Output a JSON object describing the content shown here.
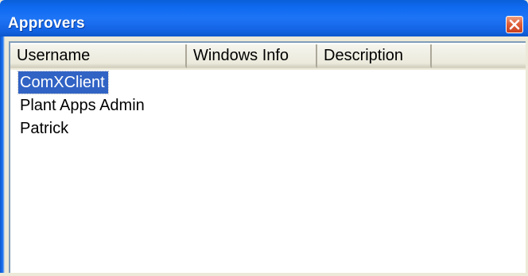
{
  "window": {
    "title": "Approvers",
    "close_icon": "close-icon",
    "accent_color": "#0f6af0",
    "close_color": "#e0603a"
  },
  "listview": {
    "columns": [
      {
        "label": "Username"
      },
      {
        "label": "Windows Info"
      },
      {
        "label": "Description"
      }
    ],
    "rows": [
      {
        "username": "ComXClient",
        "selected": true
      },
      {
        "username": "Plant Apps Admin",
        "selected": false
      },
      {
        "username": "Patrick",
        "selected": false
      }
    ],
    "selection_color": "#3163c5"
  }
}
